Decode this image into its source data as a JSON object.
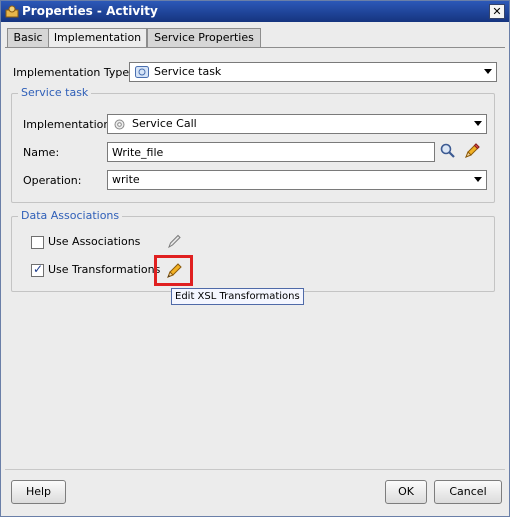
{
  "window": {
    "title": "Properties - Activity",
    "close_glyph": "✕",
    "icon": "properties-window-icon"
  },
  "tabs": [
    {
      "label": "Basic",
      "active": false
    },
    {
      "label": "Implementation",
      "active": true
    },
    {
      "label": "Service Properties",
      "active": false
    }
  ],
  "implementation_type": {
    "label": "Implementation Type:",
    "value": "Service task",
    "icon": "service-task-icon"
  },
  "service_task_group": {
    "legend": "Service task",
    "implementation": {
      "label": "Implementation:",
      "value": "Service Call",
      "icon": "gear-icon"
    },
    "name": {
      "label": "Name:",
      "value": "Write_file",
      "search_icon": "magnifier-icon",
      "edit_icon": "pencil-icon"
    },
    "operation": {
      "label": "Operation:",
      "value": "write"
    }
  },
  "data_associations_group": {
    "legend": "Data Associations",
    "use_associations": {
      "label": "Use Associations",
      "checked": false
    },
    "use_transformations": {
      "label": "Use Transformations",
      "checked": true
    },
    "checkmark": "✓"
  },
  "tooltip": {
    "text": "Edit XSL Transformations"
  },
  "footer": {
    "help_label": "Help",
    "ok_label": "OK",
    "cancel_label": "Cancel"
  },
  "colors": {
    "title_bar": "#1f44a0",
    "group_legend": "#2f5fb8",
    "highlight_border": "#e02020"
  }
}
